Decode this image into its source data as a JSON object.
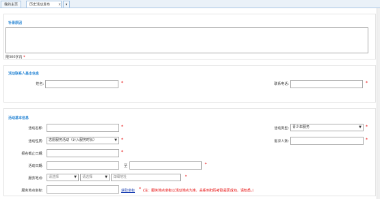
{
  "tabs": [
    {
      "label": "我的主页"
    },
    {
      "label": "历史活动发布",
      "close": "×"
    }
  ],
  "tab_menu_icon": "▾",
  "supplement": {
    "title": "补录原因",
    "limit_text": "限300字内"
  },
  "contact": {
    "title": "活动联系人基本信息",
    "name_label": "姓名:",
    "phone_label": "联系电话:"
  },
  "activity": {
    "title": "活动基本信息",
    "name_label": "活动名称:",
    "type_label": "活动类型:",
    "type_value": "青少年服务",
    "nature_label": "活动性质:",
    "nature_value": "志愿服务活动（计入服务时长）",
    "demand_label": "需求人数:",
    "deadline_label": "报名截止日期:",
    "date_label": "活动日期:",
    "date_to": "至",
    "location_label": "服务地点:",
    "loc_select1": "请选择",
    "loc_select2": "请选择",
    "address_placeholder": "详细地址",
    "coords_label": "服务地点坐标:",
    "coords_link": "获取坐标",
    "coords_note": "(注：服务地点坐标以活动地点为准，关系到扫码考勤是否成功，请知悉。)"
  },
  "colors": {
    "accent": "#2f8ad6",
    "required": "#e60000",
    "link": "#1a3fb3"
  }
}
